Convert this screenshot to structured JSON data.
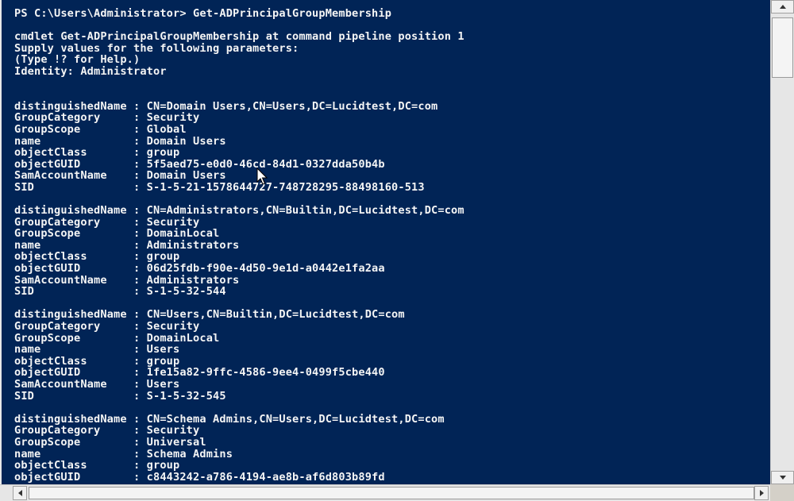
{
  "console": {
    "lines": [
      "PS C:\\Users\\Administrator> Get-ADPrincipalGroupMembership",
      "",
      "cmdlet Get-ADPrincipalGroupMembership at command pipeline position 1",
      "Supply values for the following parameters:",
      "(Type !? for Help.)",
      "Identity: Administrator",
      "",
      "",
      "distinguishedName : CN=Domain Users,CN=Users,DC=Lucidtest,DC=com",
      "GroupCategory     : Security",
      "GroupScope        : Global",
      "name              : Domain Users",
      "objectClass       : group",
      "objectGUID        : 5f5aed75-e0d0-46cd-84d1-0327dda50b4b",
      "SamAccountName    : Domain Users",
      "SID               : S-1-5-21-1578644727-748728295-88498160-513",
      "",
      "distinguishedName : CN=Administrators,CN=Builtin,DC=Lucidtest,DC=com",
      "GroupCategory     : Security",
      "GroupScope        : DomainLocal",
      "name              : Administrators",
      "objectClass       : group",
      "objectGUID        : 06d25fdb-f90e-4d50-9e1d-a0442e1fa2aa",
      "SamAccountName    : Administrators",
      "SID               : S-1-5-32-544",
      "",
      "distinguishedName : CN=Users,CN=Builtin,DC=Lucidtest,DC=com",
      "GroupCategory     : Security",
      "GroupScope        : DomainLocal",
      "name              : Users",
      "objectClass       : group",
      "objectGUID        : 1fe15a82-9ffc-4586-9ee4-0499f5cbe440",
      "SamAccountName    : Users",
      "SID               : S-1-5-32-545",
      "",
      "distinguishedName : CN=Schema Admins,CN=Users,DC=Lucidtest,DC=com",
      "GroupCategory     : Security",
      "GroupScope        : Universal",
      "name              : Schema Admins",
      "objectClass       : group",
      "objectGUID        : c8443242-a786-4194-ae8b-af6d803b89fd"
    ]
  },
  "colors": {
    "console_bg": "#012456",
    "console_text": "#f5f5f5"
  },
  "icons": {
    "mouse_pointer": "arrow-pointer-icon",
    "scroll_up": "triangle-up-icon",
    "scroll_down": "triangle-down-icon",
    "scroll_left": "triangle-left-icon",
    "scroll_right": "triangle-right-icon"
  }
}
